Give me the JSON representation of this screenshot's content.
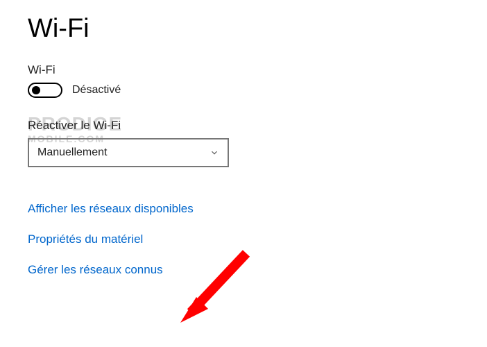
{
  "page": {
    "title": "Wi-Fi"
  },
  "wifi": {
    "section_label": "Wi-Fi",
    "toggle_state": "Désactivé"
  },
  "reactivate": {
    "label": "Réactiver le Wi-Fi",
    "selected": "Manuellement"
  },
  "links": {
    "available_networks": "Afficher les réseaux disponibles",
    "hardware_properties": "Propriétés du matériel",
    "manage_known_networks": "Gérer les réseaux connus"
  },
  "watermark": {
    "line1": "PRODIGE",
    "line2": "MOBILE.COM"
  }
}
